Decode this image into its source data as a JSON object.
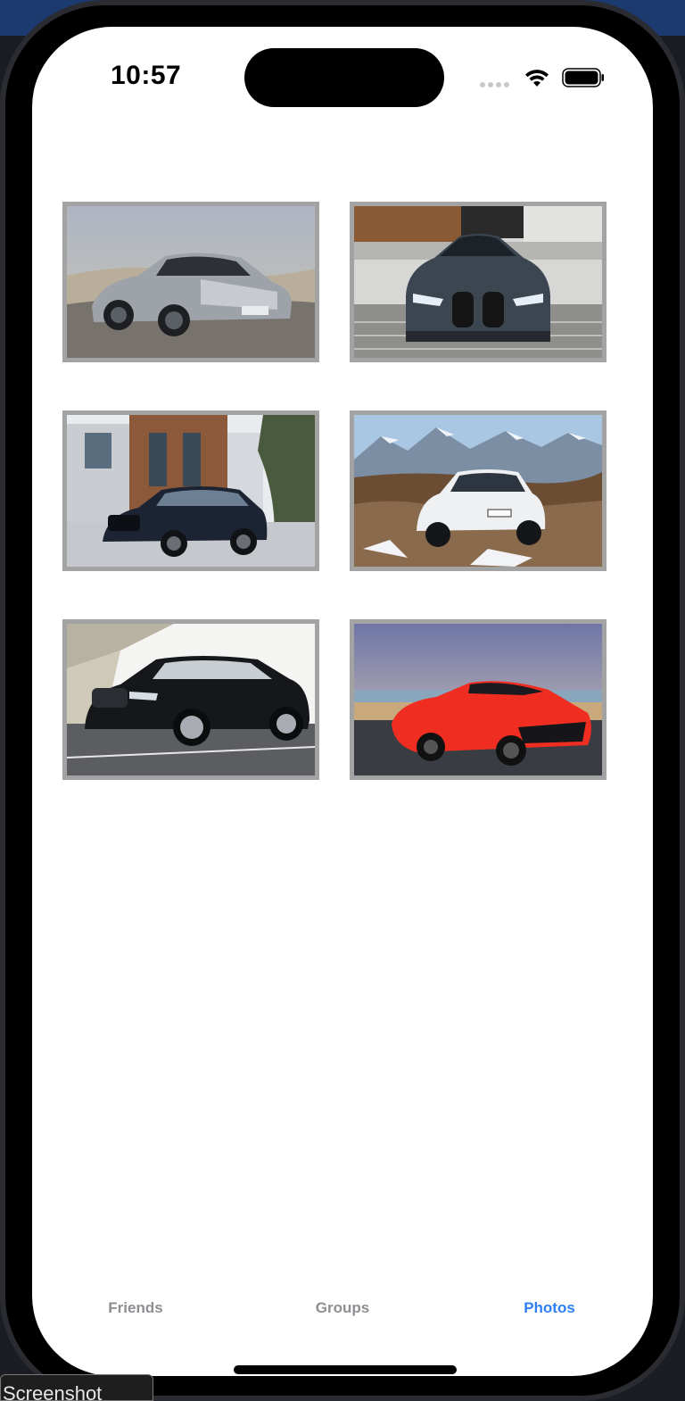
{
  "status_bar": {
    "time": "10:57"
  },
  "icons": {
    "wifi": "wifi-icon",
    "battery": "battery-icon",
    "signal": "cellular-signal-icon"
  },
  "photos": [
    {
      "name": "photo-1",
      "subject": "silver electric sedan in desert"
    },
    {
      "name": "photo-2",
      "subject": "dark grey coupe front view"
    },
    {
      "name": "photo-3",
      "subject": "dark blue SUV by modern house"
    },
    {
      "name": "photo-4",
      "subject": "white SUV on mountain terrain"
    },
    {
      "name": "photo-5",
      "subject": "black SUV under bridge"
    },
    {
      "name": "photo-6",
      "subject": "red sports convertible by sea"
    }
  ],
  "tab_bar": {
    "tabs": [
      {
        "label": "Friends",
        "active": false
      },
      {
        "label": "Groups",
        "active": false
      },
      {
        "label": "Photos",
        "active": true
      }
    ],
    "active_color": "#2f7ff6",
    "inactive_color": "#8e8e93"
  },
  "overlay": {
    "label": "Screenshot"
  }
}
